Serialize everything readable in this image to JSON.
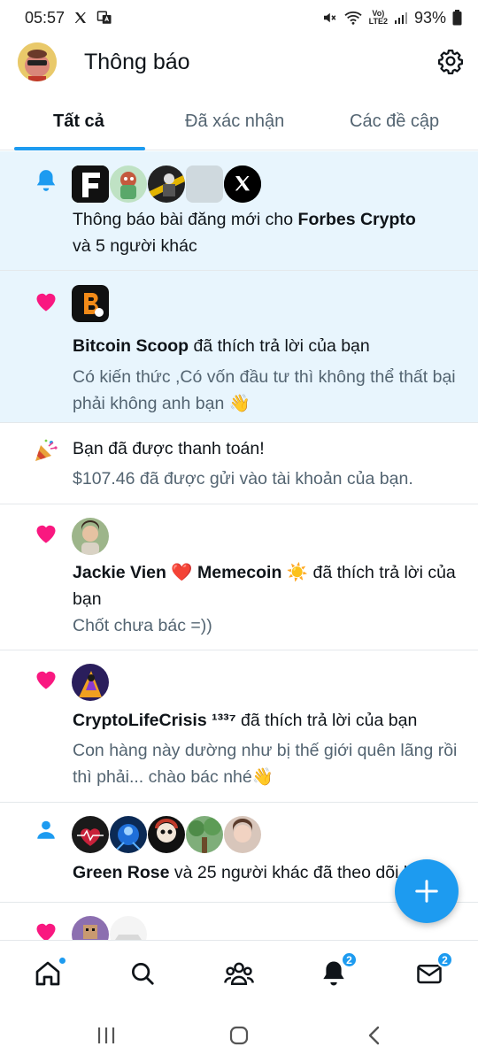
{
  "status_bar": {
    "time": "05:57",
    "battery": "93%"
  },
  "header": {
    "title": "Thông báo"
  },
  "tabs": [
    {
      "label": "Tất cả",
      "active": true
    },
    {
      "label": "Đã xác nhận",
      "active": false
    },
    {
      "label": "Các đề cập",
      "active": false
    }
  ],
  "notifications": [
    {
      "icon": "bell-icon",
      "text_pre": "Thông báo bài đăng mới cho ",
      "name": "Forbes Crypto",
      "text_post": "và 5 người khác",
      "unread": true
    },
    {
      "icon": "heart-icon",
      "name": "Bitcoin Scoop",
      "action": " đã thích trả lời của bạn",
      "preview": "Có kiến thức ,Có vốn đầu tư thì không thể thất bại phải không anh bạn 👋",
      "unread": true
    },
    {
      "icon": "party-popper-icon",
      "title": "Bạn đã được thanh toán!",
      "detail": "$107.46 đã được gửi vào tài khoản của bạn."
    },
    {
      "icon": "heart-icon",
      "name": "Jackie Vien ❤️ Memecoin ☀️",
      "action": " đã thích trả lời của bạn",
      "preview": "Chốt chưa bác =))"
    },
    {
      "icon": "heart-icon",
      "name": "CryptoLifeCrisis ¹³³⁷",
      "action": " đã thích trả lời của bạn",
      "preview": "Con hàng này dường như bị thế giới quên lãng rồi thì phải... chào bác nhé👋"
    },
    {
      "icon": "person-icon",
      "name": "Green Rose",
      "action": " và 25 người khác đã theo dõi bạn"
    },
    {
      "icon": "heart-icon"
    }
  ],
  "bottom_nav": [
    {
      "icon": "home-icon",
      "has_dot": true
    },
    {
      "icon": "search-icon"
    },
    {
      "icon": "communities-icon"
    },
    {
      "icon": "notifications-icon",
      "badge": "2"
    },
    {
      "icon": "messages-icon",
      "badge": "2"
    }
  ],
  "colors": {
    "accent": "#1d9bf0",
    "heart": "#f91880",
    "unread_bg": "#e8f5fd",
    "secondary_text": "#536471"
  }
}
